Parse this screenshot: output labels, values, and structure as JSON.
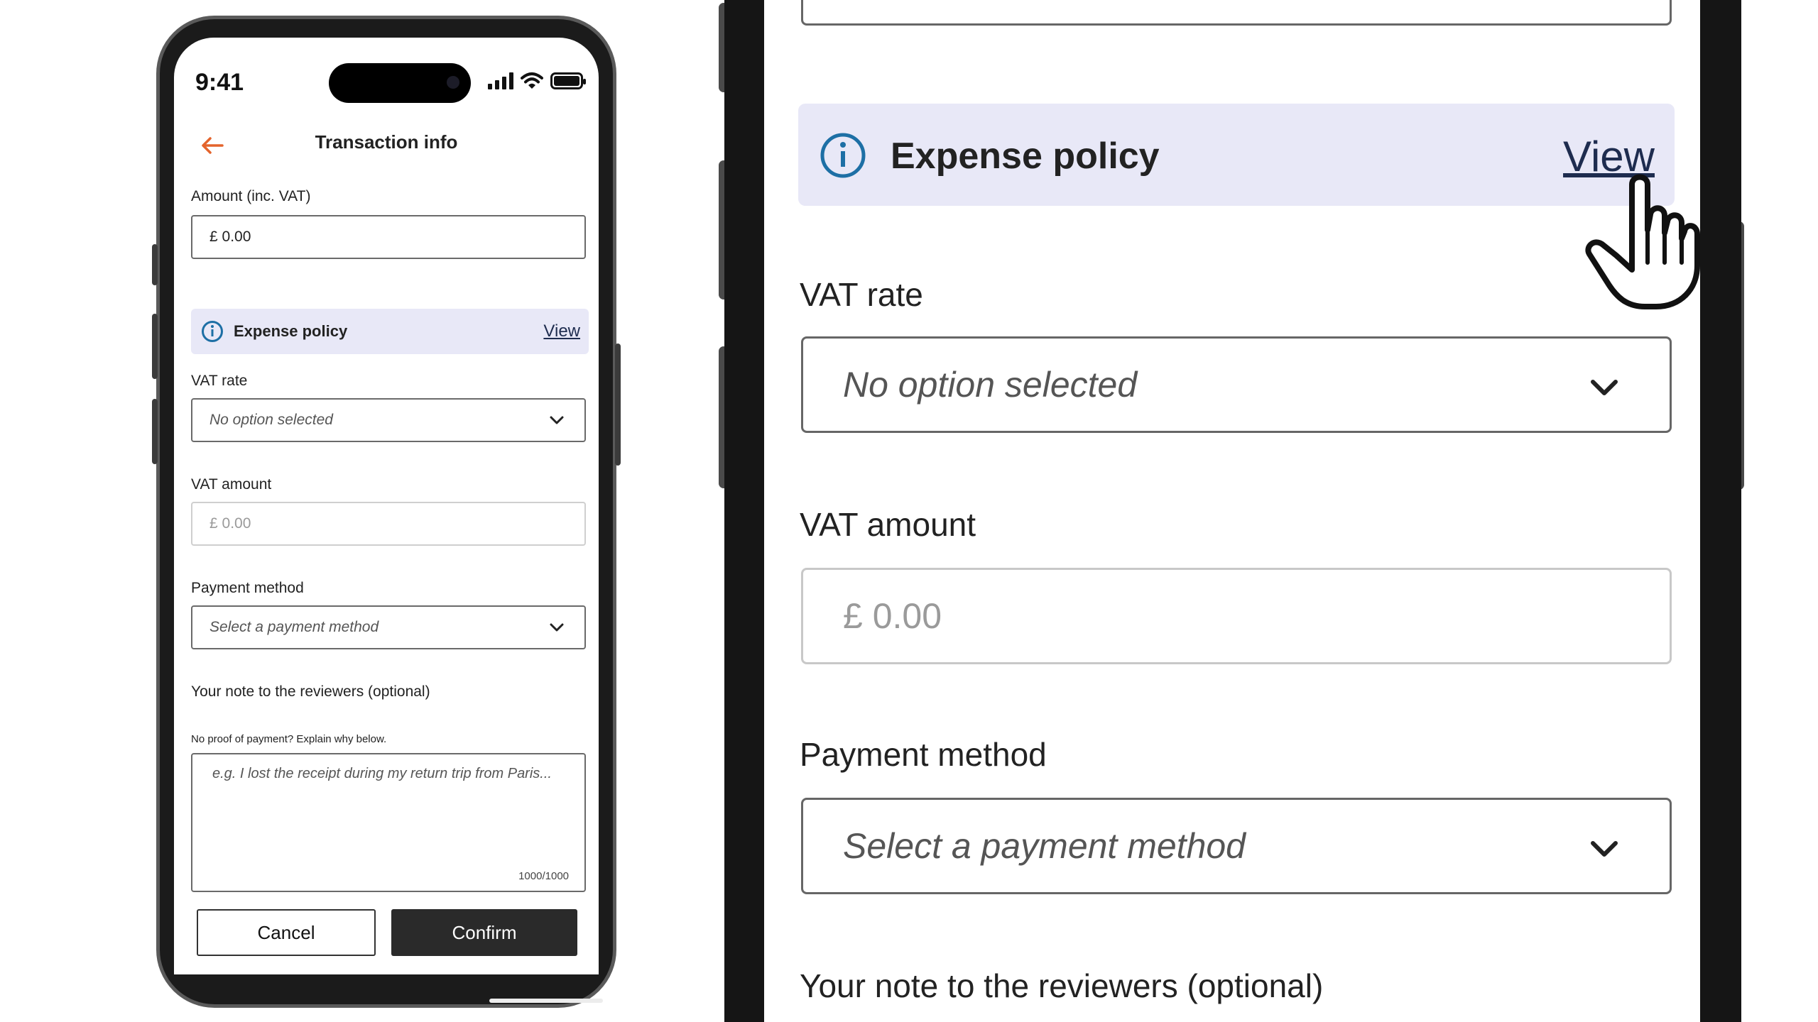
{
  "status": {
    "time": "9:41"
  },
  "header": {
    "title": "Transaction info"
  },
  "form": {
    "amount_label": "Amount (inc. VAT)",
    "amount_value": "£ 0.00",
    "policy": {
      "title": "Expense policy",
      "link": "View"
    },
    "vat_rate_label": "VAT rate",
    "vat_rate_value": "No option selected",
    "vat_amount_label": "VAT amount",
    "vat_amount_value": "£ 0.00",
    "payment_label": "Payment method",
    "payment_value": "Select a payment method",
    "note_label": "Your note to the reviewers (optional)",
    "note_hint": "No proof of payment? Explain why below.",
    "note_placeholder": "e.g. I lost the receipt during my return trip from Paris...",
    "note_counter": "1000/1000"
  },
  "actions": {
    "cancel": "Cancel",
    "confirm": "Confirm"
  },
  "icons": [
    "back-arrow-icon",
    "info-icon",
    "chevron-down-icon",
    "hand-pointer-icon",
    "signal-icon",
    "wifi-icon",
    "battery-icon"
  ],
  "colors": {
    "accent": "#e4642c",
    "policy_bg": "#e8e8f7",
    "link": "#1e2c4f",
    "info": "#1d6fa5",
    "confirm_bg": "#2a2a2a"
  }
}
